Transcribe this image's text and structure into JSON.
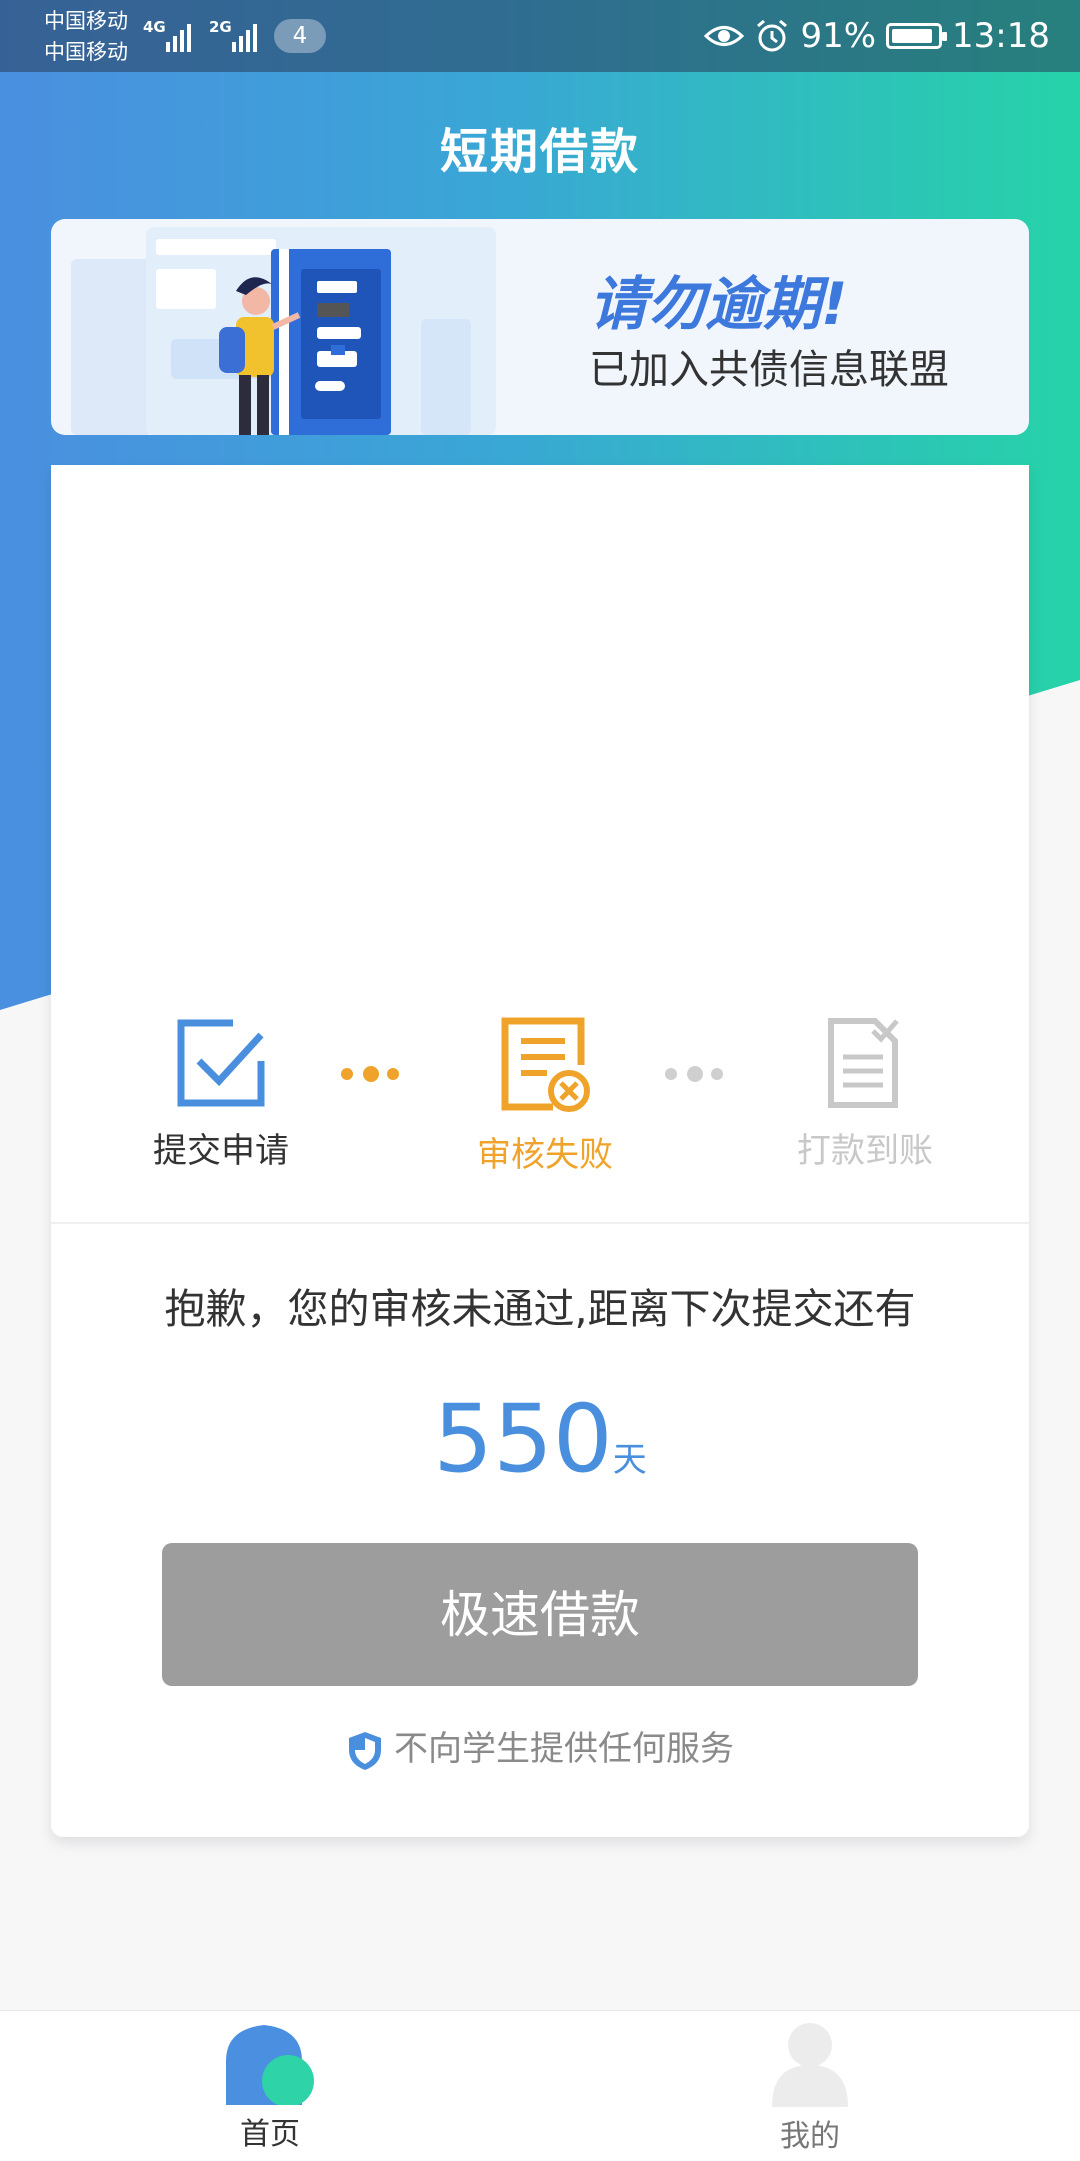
{
  "status_bar": {
    "carrier_1": "中国移动",
    "carrier_2": "中国移动",
    "network_1": "4G",
    "network_2": "2G",
    "notification_count": "4",
    "battery": "91%",
    "battery_level": 0.91,
    "time": "13:18"
  },
  "header": {
    "title": "短期借款"
  },
  "banner": {
    "heading": "请勿逾期!",
    "subtitle": "已加入共债信息联盟"
  },
  "steps": [
    {
      "label": "提交申请",
      "state": "done",
      "color": "#4a8fde"
    },
    {
      "label": "审核失败",
      "state": "failed",
      "color": "#f0a32a"
    },
    {
      "label": "打款到账",
      "state": "pending",
      "color": "#c8c8c8"
    }
  ],
  "status": {
    "message": "抱歉，您的审核未通过,距离下次提交还有",
    "countdown_value": "550",
    "countdown_unit": "天"
  },
  "action": {
    "button_label": "极速借款"
  },
  "notice": {
    "text": "不向学生提供任何服务"
  },
  "tabbar": {
    "items": [
      {
        "label": "首页",
        "active": true
      },
      {
        "label": "我的",
        "active": false
      }
    ]
  },
  "colors": {
    "accent": "#4a8fde",
    "warning": "#f0a32a",
    "disabled": "#9d9d9d",
    "gradient_start": "#4a8fe0",
    "gradient_end": "#26d3a8"
  }
}
